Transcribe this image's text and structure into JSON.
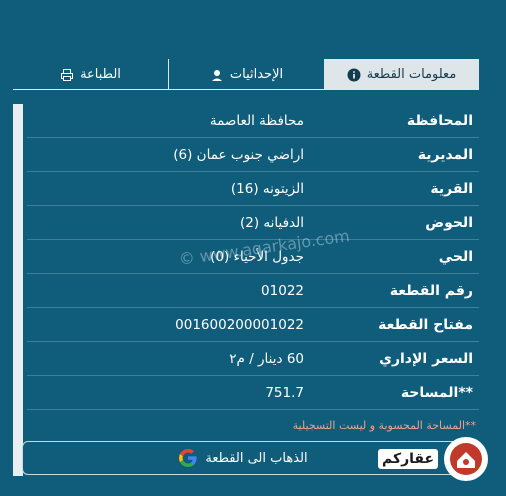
{
  "tabs": [
    {
      "label": "معلومات القطعة",
      "icon": "info-icon",
      "active": true
    },
    {
      "label": "الإحداثيات",
      "icon": "location-pin-icon",
      "active": false
    },
    {
      "label": "الطباعة",
      "icon": "printer-icon",
      "active": false
    }
  ],
  "rows": [
    {
      "label": "المحافظة",
      "value": "محافظة العاصمة"
    },
    {
      "label": "المديرية",
      "value": "اراضي جنوب عمان (6)"
    },
    {
      "label": "القرية",
      "value": "الزيتونه (16)"
    },
    {
      "label": "الحوض",
      "value": "الدفيانه (2)"
    },
    {
      "label": "الحي",
      "value": "جدول الأحياء (0)"
    },
    {
      "label": "رقم القطعة",
      "value": "01022"
    },
    {
      "label": "مفتاح القطعة",
      "value": "001600200001022"
    },
    {
      "label": "السعر الإداري",
      "value": "60 دينار / م٢"
    },
    {
      "label": "المساحة**",
      "value": "751.7"
    }
  ],
  "note": "**المساحة المحسوبة و ليست التسجيلية",
  "go_button": {
    "label": "الذهاب الى القطعة",
    "icon": "google-icon"
  },
  "watermark": "© www.aqarkajo.com",
  "logo": {
    "text": "عقاركم"
  },
  "colors": {
    "background": "#0f5d7b",
    "active_tab": "#dfe6ea",
    "note": "#f0a08c"
  }
}
